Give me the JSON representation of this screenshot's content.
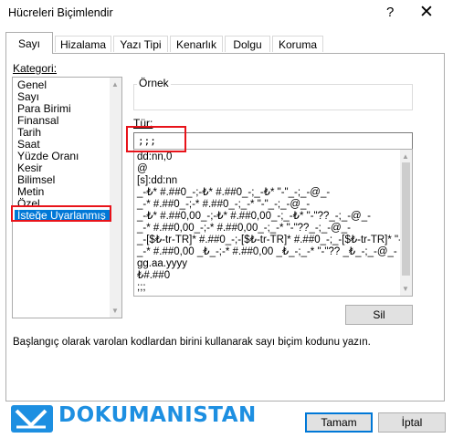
{
  "window": {
    "title": "Hücreleri Biçimlendir",
    "help": "?",
    "close": "✕"
  },
  "tabs": [
    {
      "label": "Sayı",
      "active": true
    },
    {
      "label": "Hizalama"
    },
    {
      "label": "Yazı Tipi"
    },
    {
      "label": "Kenarlık"
    },
    {
      "label": "Dolgu"
    },
    {
      "label": "Koruma"
    }
  ],
  "category": {
    "label": "Kategori:",
    "items": [
      "Genel",
      "Sayı",
      "Para Birimi",
      "Finansal",
      "Tarih",
      "Saat",
      "Yüzde Oranı",
      "Kesir",
      "Bilimsel",
      "Metin",
      "Özel",
      "İsteğe Uyarlanmış"
    ],
    "selected": "İsteğe Uyarlanmış"
  },
  "sample": {
    "label": "Örnek",
    "value": ""
  },
  "type": {
    "label": "Tür:",
    "value": ";;;",
    "formats": [
      "dd:nn,0",
      "@",
      "[s]:dd:nn",
      "_-₺* #.##0_-;-₺* #.##0_-;_-₺* \"-\"_-;_-@_-",
      "_-* #.##0_-;-* #.##0_-;_-* \"-\"_-;_-@_-",
      "_-₺* #.##0,00_-;-₺* #.##0,00_-;_-₺* \"-\"??_-;_-@_-",
      "_-* #.##0,00_-;-* #.##0,00_-;_-* \"-\"??_-;_-@_-",
      "_-[$₺-tr-TR]* #.##0_-;-[$₺-tr-TR]* #.##0_-;_-[$₺-tr-TR]* \"-\"",
      "_-* #.##0,00 _₺_-;-* #.##0,00 _₺_-;_-* \"-\"?? _₺_-;_-@_-",
      "gg.aa.yyyy",
      "₺#.##0",
      ";;;"
    ]
  },
  "buttons": {
    "delete": "Sil",
    "ok": "Tamam",
    "cancel": "İptal"
  },
  "description": "Başlangıç olarak varolan kodlardan birini kullanarak sayı biçim kodunu yazın.",
  "watermark": {
    "text": "DOKUMANISTAN",
    "color": "#1d8fe1"
  },
  "colors": {
    "selection": "#0078d7",
    "highlight_box": "#e8131a"
  }
}
